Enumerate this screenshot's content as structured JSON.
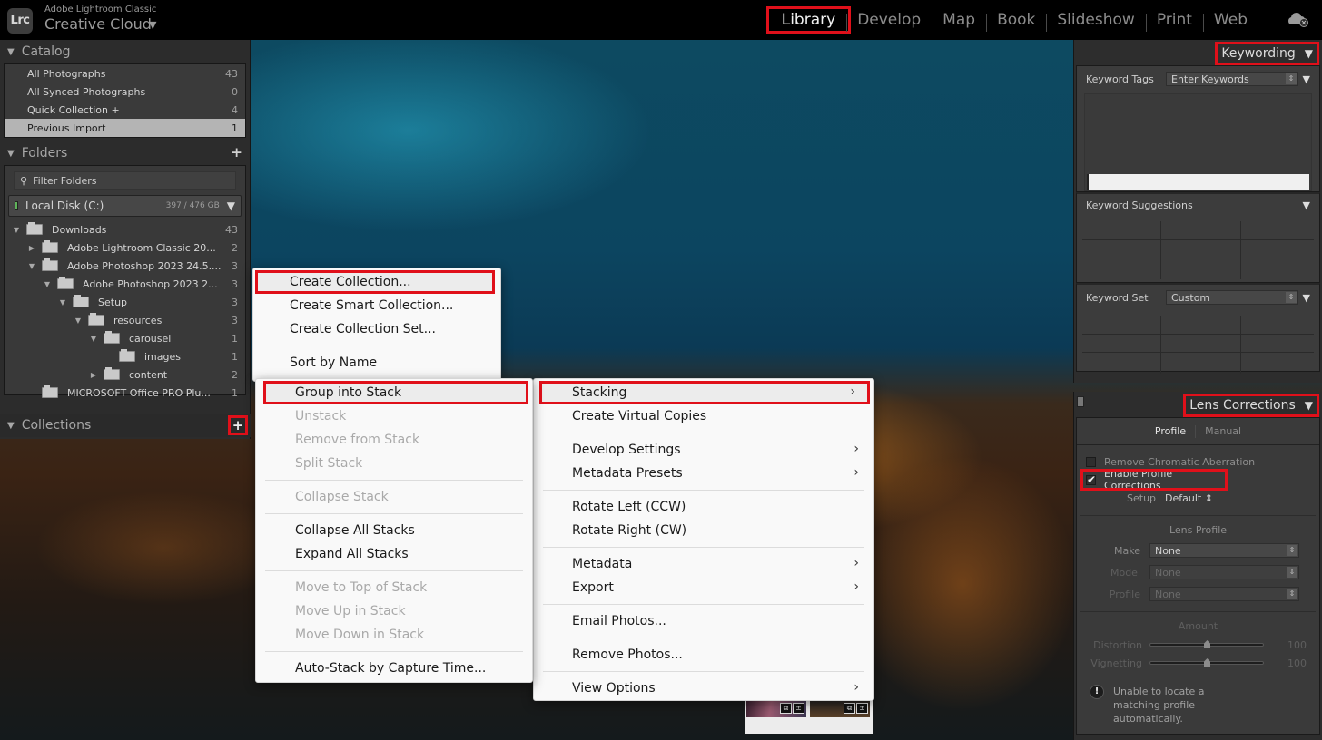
{
  "app": {
    "logo_text": "Lrc",
    "subtitle": "Adobe Lightroom Classic",
    "title": "Creative Cloud",
    "title_caret": "▼"
  },
  "modules": [
    {
      "label": "Library",
      "active": true
    },
    {
      "label": "Develop"
    },
    {
      "label": "Map"
    },
    {
      "label": "Book"
    },
    {
      "label": "Slideshow"
    },
    {
      "label": "Print"
    },
    {
      "label": "Web"
    }
  ],
  "cloud_icon": "cloud-sync-status-icon",
  "catalog": {
    "title": "Catalog",
    "items": [
      {
        "label": "All Photographs",
        "count": "43"
      },
      {
        "label": "All Synced Photographs",
        "count": "0"
      },
      {
        "label": "Quick Collection +",
        "count": "4"
      },
      {
        "label": "Previous Import",
        "count": "1",
        "selected": true
      }
    ]
  },
  "folders": {
    "title": "Folders",
    "add_icon": "+",
    "filter_placeholder": "Filter Folders",
    "volume": {
      "name": "Local Disk (C:)",
      "size": "397 / 476 GB"
    },
    "tree": [
      {
        "name": "Downloads",
        "count": "43",
        "level": 0,
        "expander": "▼"
      },
      {
        "name": "Adobe Lightroom Classic 20...",
        "count": "2",
        "level": 1,
        "expander": "▶"
      },
      {
        "name": "Adobe Photoshop 2023 24.5....",
        "count": "3",
        "level": 1,
        "expander": "▼"
      },
      {
        "name": "Adobe Photoshop 2023 2...",
        "count": "3",
        "level": 2,
        "expander": "▼"
      },
      {
        "name": "Setup",
        "count": "3",
        "level": 3,
        "expander": "▼"
      },
      {
        "name": "resources",
        "count": "3",
        "level": 4,
        "expander": "▼"
      },
      {
        "name": "carousel",
        "count": "1",
        "level": 5,
        "expander": "▼"
      },
      {
        "name": "images",
        "count": "1",
        "level": 6,
        "expander": ""
      },
      {
        "name": "content",
        "count": "2",
        "level": 5,
        "expander": "▶"
      },
      {
        "name": "MICROSOFT Office PRO Plu...",
        "count": "1",
        "level": 1,
        "expander": ""
      }
    ]
  },
  "collections": {
    "title": "Collections",
    "add_icon": "+"
  },
  "keywording": {
    "title": "Keywording",
    "keyword_tags_label": "Keyword Tags",
    "keyword_tags_value": "Enter Keywords",
    "keyword_input_value": "",
    "suggestions_label": "Keyword Suggestions",
    "keyword_set_label": "Keyword Set",
    "keyword_set_value": "Custom"
  },
  "lens_corrections": {
    "title": "Lens Corrections",
    "tabs": [
      {
        "label": "Profile",
        "active": true
      },
      {
        "label": "Manual"
      }
    ],
    "remove_ca": {
      "label": "Remove Chromatic Aberration",
      "checked": false
    },
    "enable_profile": {
      "label": "Enable Profile Corrections",
      "checked": true
    },
    "setup_label": "Setup",
    "setup_value": "Default ⇕",
    "lens_profile_label": "Lens Profile",
    "make_label": "Make",
    "make_value": "None",
    "model_label": "Model",
    "model_value": "None",
    "profile_label": "Profile",
    "profile_value": "None",
    "amount_label": "Amount",
    "distortion_label": "Distortion",
    "distortion_value": "100",
    "distortion_fraction": 0.5,
    "vignetting_label": "Vignetting",
    "vignetting_value": "100",
    "vignetting_fraction": 0.5,
    "warning": "Unable to locate a matching profile automatically."
  },
  "collection_menu": {
    "items": [
      {
        "label": "Create Collection...",
        "highlighted": true
      },
      {
        "label": "Create Smart Collection..."
      },
      {
        "label": "Create Collection Set..."
      },
      {
        "separator": true
      },
      {
        "label": "Sort by Name"
      }
    ]
  },
  "stacking_menu": {
    "items": [
      {
        "label": "Group into Stack",
        "highlighted": true
      },
      {
        "label": "Unstack",
        "disabled": true
      },
      {
        "label": "Remove from Stack",
        "disabled": true
      },
      {
        "label": "Split Stack",
        "disabled": true
      },
      {
        "separator": true
      },
      {
        "label": "Collapse Stack",
        "disabled": true
      },
      {
        "separator": true
      },
      {
        "label": "Collapse All Stacks"
      },
      {
        "label": "Expand All Stacks"
      },
      {
        "separator": true
      },
      {
        "label": "Move to Top of Stack",
        "disabled": true
      },
      {
        "label": "Move Up in Stack",
        "disabled": true
      },
      {
        "label": "Move Down in Stack",
        "disabled": true
      },
      {
        "separator": true
      },
      {
        "label": "Auto-Stack by Capture Time..."
      }
    ]
  },
  "photo_menu": {
    "items": [
      {
        "label": "Stacking",
        "submenu": true,
        "highlighted": true
      },
      {
        "label": "Create Virtual Copies"
      },
      {
        "separator": true
      },
      {
        "label": "Develop Settings",
        "submenu": true
      },
      {
        "label": "Metadata Presets",
        "submenu": true
      },
      {
        "separator": true
      },
      {
        "label": "Rotate Left (CCW)"
      },
      {
        "label": "Rotate Right (CW)"
      },
      {
        "separator": true
      },
      {
        "label": "Metadata",
        "submenu": true
      },
      {
        "label": "Export",
        "submenu": true
      },
      {
        "separator": true
      },
      {
        "label": "Email Photos..."
      },
      {
        "separator": true
      },
      {
        "label": "Remove Photos..."
      },
      {
        "separator": true
      },
      {
        "label": "View Options",
        "submenu": true
      }
    ]
  },
  "thumb_badges": [
    "⧉",
    "±"
  ],
  "colors": {
    "highlight_outline": "#e0101a",
    "panel_bg": "#2c2c2c",
    "menu_bg": "#f9f9f9"
  }
}
